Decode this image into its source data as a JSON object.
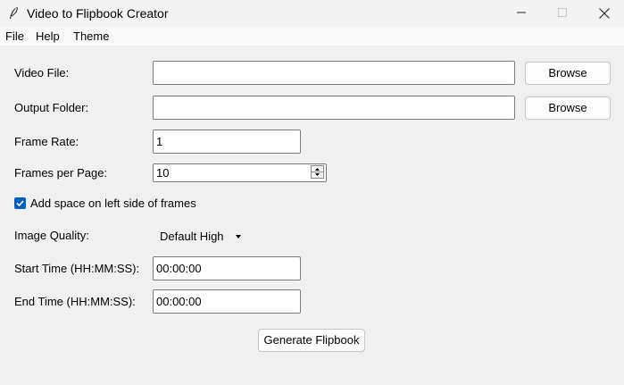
{
  "window": {
    "title": "Video to Flipbook Creator",
    "icon": "feather-icon"
  },
  "menu": {
    "items": [
      "File",
      "Help",
      "Theme"
    ]
  },
  "form": {
    "video_file": {
      "label": "Video File:",
      "value": "",
      "browse_label": "Browse"
    },
    "output_folder": {
      "label": "Output Folder:",
      "value": "",
      "browse_label": "Browse"
    },
    "frame_rate": {
      "label": "Frame Rate:",
      "value": "1"
    },
    "frames_per_page": {
      "label": "Frames per Page:",
      "value": "10"
    },
    "left_space": {
      "label": "Add space on left side of frames",
      "checked": true
    },
    "image_quality": {
      "label": "Image Quality:",
      "value": "Default High"
    },
    "start_time": {
      "label": "Start Time (HH:MM:SS):",
      "value": "00:00:00"
    },
    "end_time": {
      "label": "End Time (HH:MM:SS):",
      "value": "00:00:00"
    },
    "generate_label": "Generate Flipbook"
  },
  "colors": {
    "accent": "#005fb8",
    "background": "#f0f0f0"
  }
}
